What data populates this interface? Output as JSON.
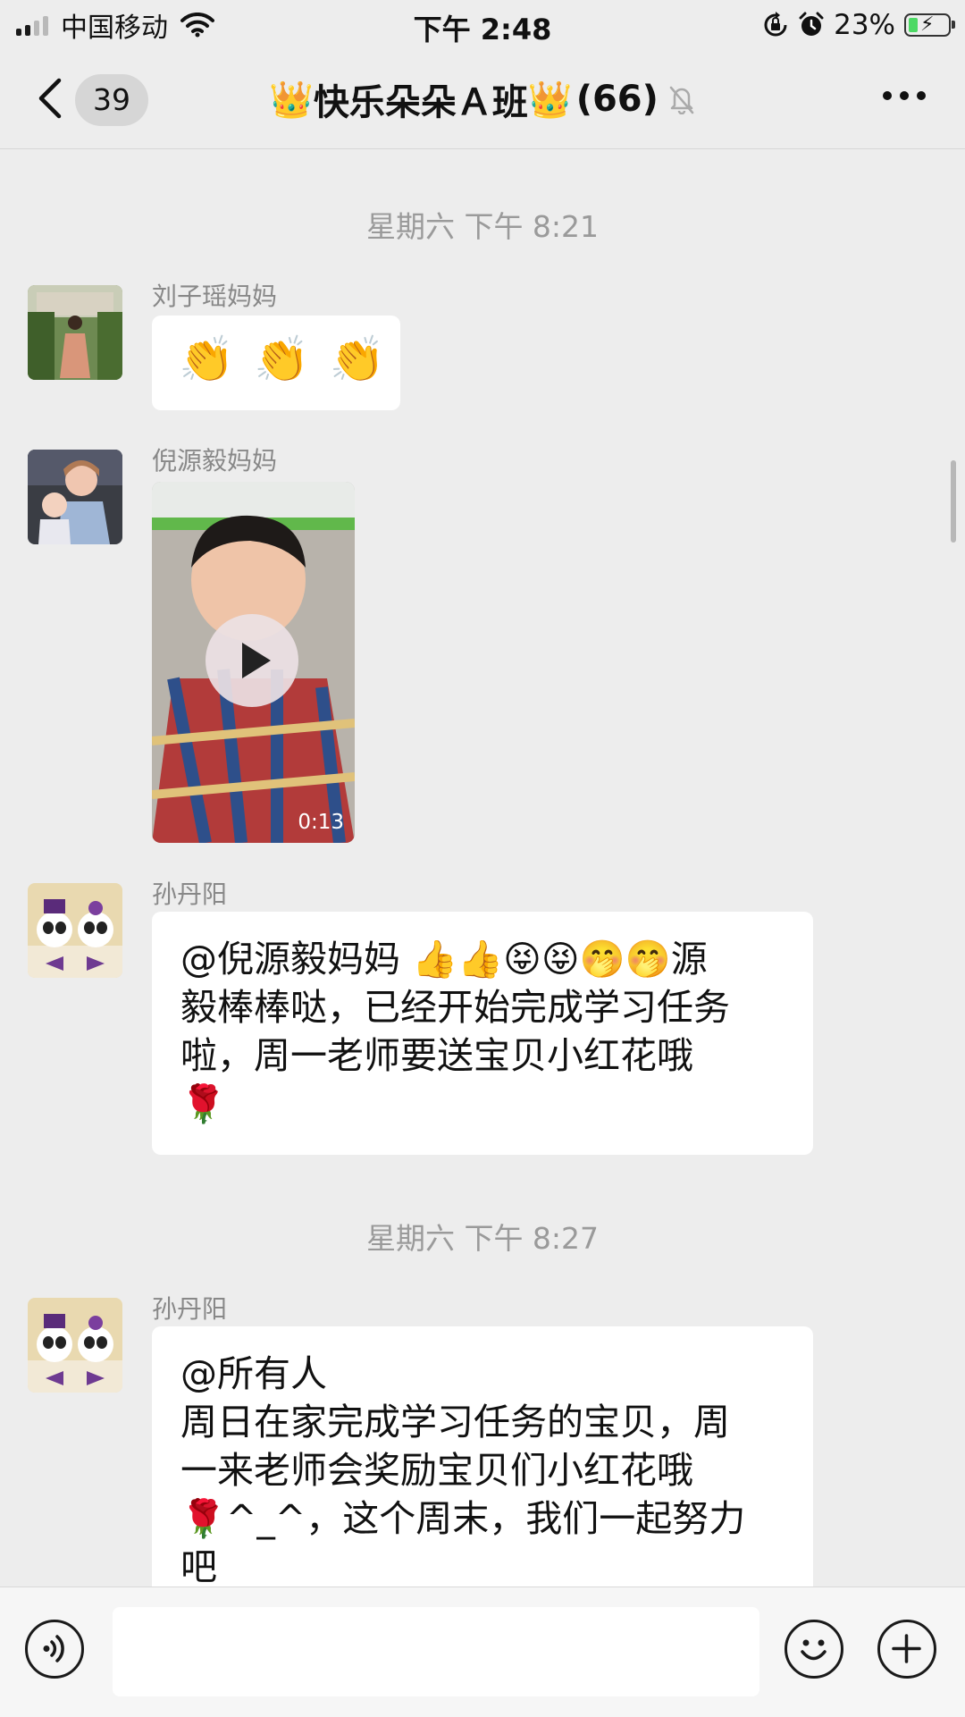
{
  "status_bar": {
    "carrier": "中国移动",
    "time": "下午 2:48",
    "battery_percent": "23%",
    "battery_level": 0.23,
    "icons": [
      "signal-icon",
      "wifi-icon",
      "orientation-lock-icon",
      "alarm-icon",
      "battery-charging-icon"
    ]
  },
  "nav": {
    "unread_count": "39",
    "crown_left": "👑",
    "title": "快乐朵朵Ａ班",
    "crown_right": "👑",
    "member_count": "(66)",
    "icons": [
      "back-icon",
      "mute-bell-icon",
      "more-icon"
    ]
  },
  "chat": {
    "timestamp_1": "星期六 下午 8:21",
    "msg_1": {
      "sender": "刘子瑶妈妈",
      "emojis": [
        "👏",
        "👏",
        "👏"
      ]
    },
    "msg_2": {
      "sender": "倪源毅妈妈",
      "video_duration": "0:13"
    },
    "msg_3": {
      "sender": "孙丹阳",
      "text": "@倪源毅妈妈 👍👍😝😝🤭🤭源\n毅棒棒哒，已经开始完成学习任务\n啦，周一老师要送宝贝小红花哦\n🌹"
    },
    "timestamp_2": "星期六 下午 8:27",
    "msg_4": {
      "sender": "孙丹阳",
      "text": "@所有人\n周日在家完成学习任务的宝贝，周\n一来老师会奖励宝贝们小红花哦\n🌹^_^，这个周末，我们一起努力\n吧"
    }
  },
  "input_bar": {
    "icons": [
      "voice-icon",
      "emoji-icon",
      "plus-icon"
    ]
  },
  "colors": {
    "background": "#ededed",
    "bubble": "#ffffff",
    "timestamp": "#9a9a9a",
    "battery_fill": "#4cd964"
  }
}
